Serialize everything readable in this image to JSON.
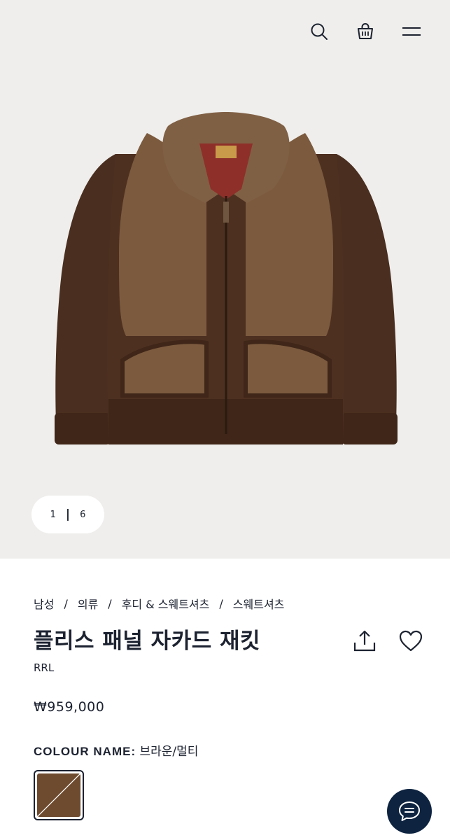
{
  "header": {
    "icons": [
      "search-icon",
      "shopping-bag-icon",
      "menu-icon"
    ]
  },
  "gallery": {
    "current": "1",
    "total": "6"
  },
  "breadcrumb": [
    "남성",
    "의류",
    "후디 & 스웨트셔츠",
    "스웨트셔츠"
  ],
  "product": {
    "title": "플리스 패널 자카드 재킷",
    "brand": "RRL",
    "price": "₩959,000",
    "colour_label": "COLOUR NAME:",
    "colour_value": "브라운/멀티"
  },
  "colors": {
    "hero_background": "#efeeec",
    "text": "#1c2230",
    "jacket_wool": "#4a2e1f",
    "jacket_fleece": "#7b5a3e",
    "swatch": "#6e4a2e",
    "chat_button": "#0d2340"
  }
}
